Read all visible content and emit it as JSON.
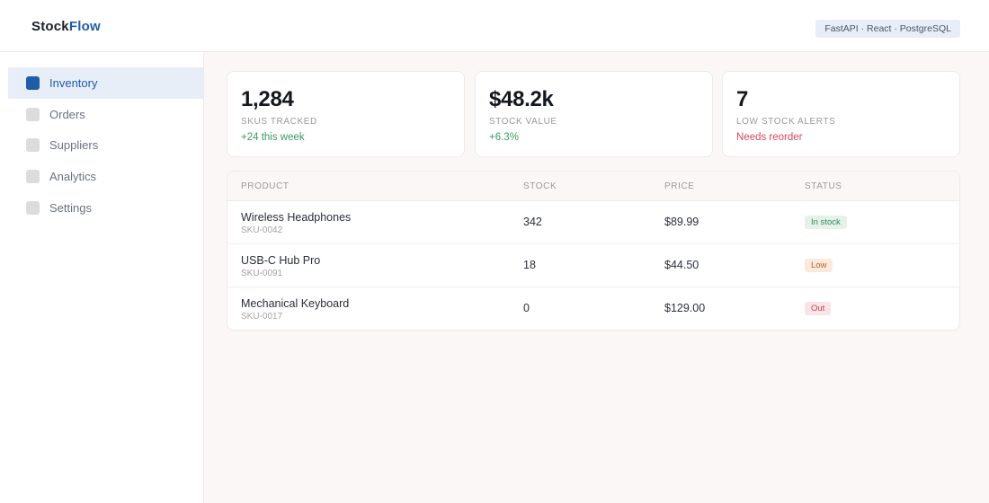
{
  "header": {
    "brand_part1": "Stock",
    "brand_part2": "Flow",
    "tech_badge": "FastAPI · React · PostgreSQL"
  },
  "sidebar": {
    "items": [
      {
        "label": "Inventory",
        "icon": "inventory-icon",
        "active": true
      },
      {
        "label": "Orders",
        "icon": "orders-icon",
        "active": false
      },
      {
        "label": "Suppliers",
        "icon": "suppliers-icon",
        "active": false
      },
      {
        "label": "Analytics",
        "icon": "analytics-icon",
        "active": false
      },
      {
        "label": "Settings",
        "icon": "settings-icon",
        "active": false
      }
    ]
  },
  "stats": [
    {
      "value": "1,284",
      "label": "SKUS TRACKED",
      "sub": "+24 this week",
      "tone": "positive"
    },
    {
      "value": "$48.2k",
      "label": "STOCK VALUE",
      "sub": "+6.3%",
      "tone": "positive"
    },
    {
      "value": "7",
      "label": "LOW STOCK ALERTS",
      "sub": "Needs reorder",
      "tone": "negative"
    }
  ],
  "table": {
    "headers": {
      "product": "PRODUCT",
      "stock": "STOCK",
      "price": "PRICE",
      "status": "STATUS"
    },
    "rows": [
      {
        "name": "Wireless Headphones",
        "sku": "SKU-0042",
        "stock": "342",
        "price": "$89.99",
        "status": "In stock"
      },
      {
        "name": "USB-C Hub Pro",
        "sku": "SKU-0091",
        "stock": "18",
        "price": "$44.50",
        "status": "Low"
      },
      {
        "name": "Mechanical Keyboard",
        "sku": "SKU-0017",
        "stock": "0",
        "price": "$129.00",
        "status": "Out"
      }
    ]
  },
  "colors": {
    "accent": "#1f5da8",
    "positive": "#3c9a64",
    "negative": "#d2495d"
  }
}
